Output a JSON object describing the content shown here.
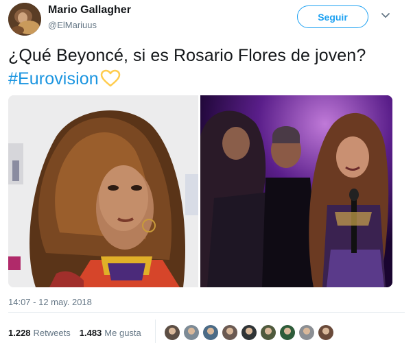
{
  "tweet": {
    "author_name": "Mario Gallagher",
    "author_handle": "@ElMariuus",
    "follow_label": "Seguir",
    "text_plain": "¿Qué Beyoncé, si es Rosario Flores de joven?",
    "hashtag": "#Eurovision",
    "emoji": "yellow-heart-icon",
    "timestamp": "14:07 - 12 may. 2018",
    "retweets_count": "1.228",
    "retweets_label": "Retweets",
    "likes_count": "1.483",
    "likes_label": "Me gusta",
    "liker_avatars": [
      {
        "color": "#5c4e44"
      },
      {
        "color": "#7d8b96"
      },
      {
        "color": "#4b6b86"
      },
      {
        "color": "#6b5a52"
      },
      {
        "color": "#2f3436"
      },
      {
        "color": "#4f5a3d"
      },
      {
        "color": "#2e5c3a"
      },
      {
        "color": "#8b8f94"
      },
      {
        "color": "#6a4a3a"
      }
    ]
  },
  "colors": {
    "link": "#1b95e0",
    "follow": "#1da1f2",
    "heart": "#ffcc4d"
  }
}
